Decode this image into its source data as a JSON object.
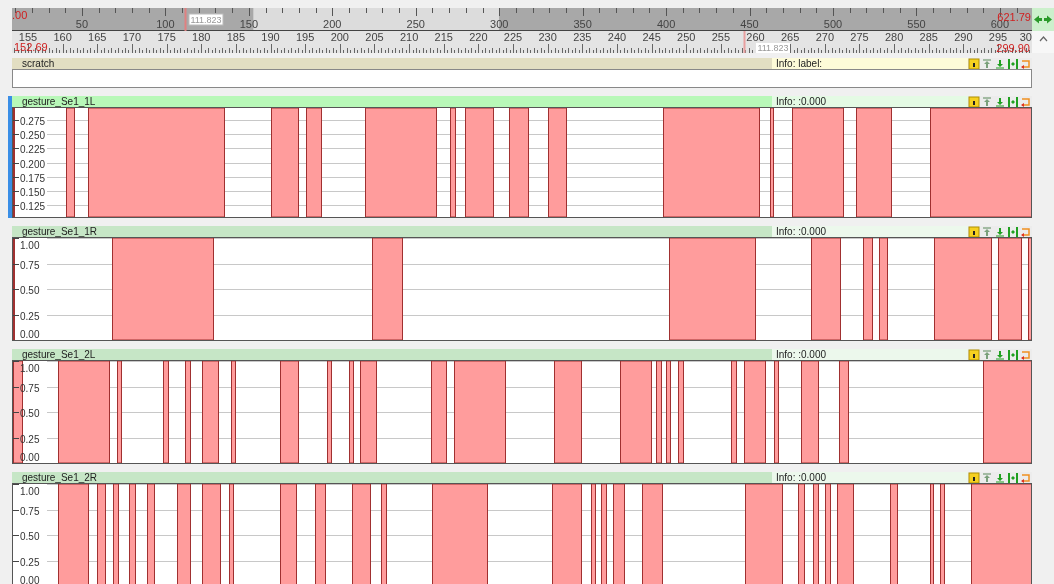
{
  "overview_ruler": {
    "start_label": ".00",
    "end_label": "621.79",
    "cursor_label": "111.823",
    "labels": [
      "50",
      "100",
      "150",
      "200",
      "250",
      "300",
      "350",
      "400",
      "450",
      "500",
      "550",
      "600"
    ]
  },
  "detail_ruler": {
    "start_label": "152.69",
    "end_label": "299.90",
    "cursor_label": "111.823",
    "labels": [
      "155",
      "160",
      "165",
      "170",
      "175",
      "180",
      "185",
      "190",
      "195",
      "200",
      "205",
      "210",
      "215",
      "220",
      "225",
      "230",
      "235",
      "240",
      "245",
      "250",
      "255",
      "260",
      "265",
      "270",
      "275",
      "280",
      "285",
      "290",
      "295",
      "30"
    ]
  },
  "tracks": [
    {
      "kind": "label",
      "name": "scratch",
      "info": "Info: label:",
      "selected": false
    },
    {
      "kind": "signal",
      "name": "gesture_Se1_1L",
      "info": "Info: :0.000",
      "selected": true,
      "axis_labels": [
        "0.275",
        "0.250",
        "0.225",
        "0.200",
        "0.175",
        "0.150",
        "0.125"
      ]
    },
    {
      "kind": "signal",
      "name": "gesture_Se1_1R",
      "info": "Info: :0.000",
      "selected": false,
      "axis_labels": [
        "1.00",
        "0.75",
        "0.50",
        "0.25",
        "0.00"
      ]
    },
    {
      "kind": "signal",
      "name": "gesture_Se1_2L",
      "info": "Info: :0.000",
      "selected": false,
      "axis_labels": [
        "1.00",
        "0.75",
        "0.50",
        "0.25",
        "0.00"
      ]
    },
    {
      "kind": "signal",
      "name": "gesture_Se1_2R",
      "info": "Info: :0.000",
      "selected": false,
      "axis_labels": [
        "1.00",
        "0.75",
        "0.50",
        "0.25",
        "0.00"
      ]
    }
  ]
}
